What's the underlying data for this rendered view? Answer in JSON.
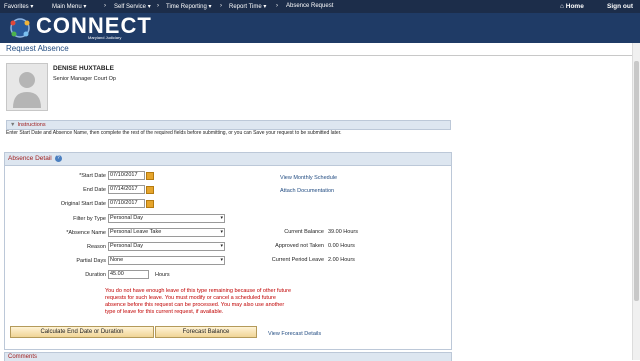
{
  "topnav": {
    "favorites": "Favorites",
    "main_menu": "Main Menu",
    "self_service": "Self Service",
    "time_reporting": "Time Reporting",
    "report_time": "Report Time",
    "absence_request": "Absence Request",
    "home": "Home",
    "sign_out": "Sign out"
  },
  "brand": {
    "logo": "CONNECT",
    "subtitle": "Maryland Judiciary"
  },
  "page": {
    "title": "Request Absence"
  },
  "employee": {
    "name": "DENISE HUXTABLE",
    "role": "Senior Manager Court Op"
  },
  "instructions": {
    "header": "Instructions",
    "text": "Enter Start Date and Absence Name, then complete the rest of the required fields before submitting, or you can Save your request to be submitted later."
  },
  "absence_detail": {
    "header": "Absence Detail",
    "start_date_label": "*Start Date",
    "start_date": "07/10/2017",
    "end_date_label": "End Date",
    "end_date": "07/14/2017",
    "original_start_label": "Original Start Date",
    "original_start": "07/10/2017",
    "filter_label": "Filter by Type",
    "filter_value": "Personal Day",
    "absence_name_label": "*Absence Name",
    "absence_name": "Personal Leave Take",
    "reason_label": "Reason",
    "reason": "Personal Day",
    "partial_label": "Partial Days",
    "partial": "None",
    "duration_label": "Duration",
    "duration": "45.00",
    "duration_unit": "Hours",
    "view_schedule": "View Monthly Schedule",
    "attach_doc": "Attach Documentation",
    "current_balance_label": "Current Balance",
    "current_balance": "39.00 Hours",
    "approved_label": "Approved not Taken",
    "approved": "0.00 Hours",
    "period_label": "Current Period Leave",
    "period": "2.00 Hours",
    "warning": "You do not have enough leave of this type remaining because of other future requests for such leave. You must modify or cancel a scheduled future absence before this request can be processed. You may also use another type of leave for this current request, if available.",
    "calc_button": "Calculate End Date or Duration",
    "forecast_button": "Forecast Balance",
    "view_forecast": "View Forecast Details"
  },
  "comments": {
    "header": "Comments"
  }
}
